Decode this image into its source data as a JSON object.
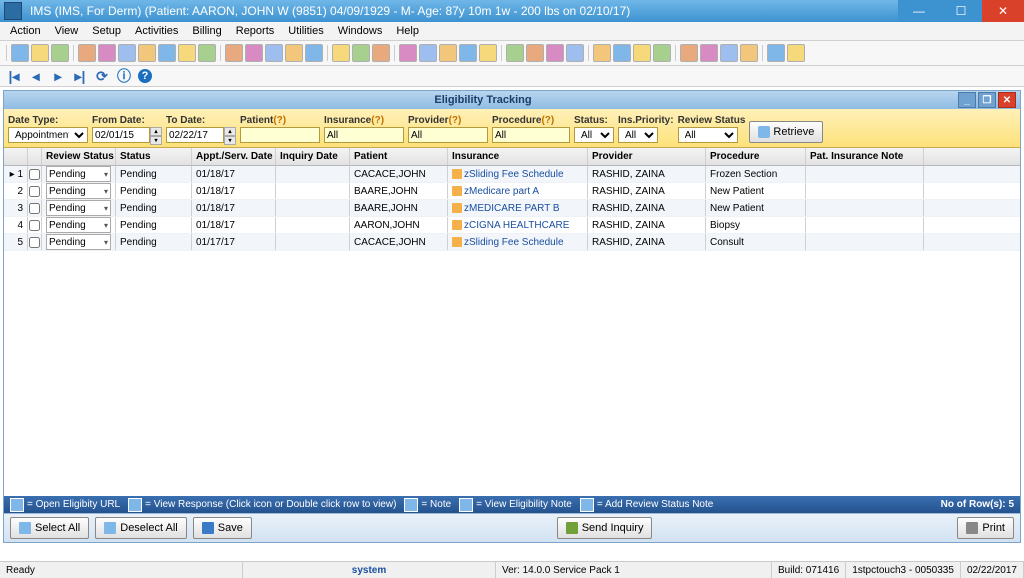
{
  "window": {
    "title": "IMS (IMS, For Derm)    (Patient: AARON, JOHN W (9851) 04/09/1929 - M- Age: 87y 10m 1w - 200 lbs on 02/10/17)"
  },
  "menu": [
    "Action",
    "View",
    "Setup",
    "Activities",
    "Billing",
    "Reports",
    "Utilities",
    "Windows",
    "Help"
  ],
  "panel_title": "Eligibility Tracking",
  "filters": {
    "date_type": {
      "label": "Date Type:",
      "value": "Appointment Da"
    },
    "from_date": {
      "label": "From Date:",
      "value": "02/01/15"
    },
    "to_date": {
      "label": "To Date:",
      "value": "02/22/17"
    },
    "patient": {
      "label": "Patient",
      "q": "(?)",
      "value": ""
    },
    "insurance": {
      "label": "Insurance",
      "q": "(?)",
      "value": "All"
    },
    "provider": {
      "label": "Provider",
      "q": "(?)",
      "value": "All"
    },
    "procedure": {
      "label": "Procedure",
      "q": "(?)",
      "value": "All"
    },
    "status": {
      "label": "Status:",
      "value": "All"
    },
    "ins_priority": {
      "label": "Ins.Priority:",
      "value": "All"
    },
    "review_status": {
      "label": "Review Status",
      "value": "All"
    },
    "retrieve": "Retrieve"
  },
  "grid": {
    "headers": {
      "rs": "Review Status",
      "st": "Status",
      "dt": "Appt./Serv. Date",
      "iq": "Inquiry Date",
      "pt": "Patient",
      "ins": "Insurance",
      "prov": "Provider",
      "proc": "Procedure",
      "note": "Pat. Insurance Note"
    },
    "rows": [
      {
        "n": "1",
        "rs": "Pending",
        "st": "Pending",
        "dt": "01/18/17",
        "iq": "",
        "pt": "CACACE,JOHN",
        "ins": "Sliding Fee Schedule",
        "prov": "RASHID, ZAINA",
        "proc": "Frozen Section",
        "note": ""
      },
      {
        "n": "2",
        "rs": "Pending",
        "st": "Pending",
        "dt": "01/18/17",
        "iq": "",
        "pt": "BAARE,JOHN",
        "ins": "Medicare part A",
        "prov": "RASHID, ZAINA",
        "proc": "New Patient",
        "note": ""
      },
      {
        "n": "3",
        "rs": "Pending",
        "st": "Pending",
        "dt": "01/18/17",
        "iq": "",
        "pt": "BAARE,JOHN",
        "ins": "MEDICARE PART B",
        "prov": "RASHID, ZAINA",
        "proc": "New Patient",
        "note": ""
      },
      {
        "n": "4",
        "rs": "Pending",
        "st": "Pending",
        "dt": "01/18/17",
        "iq": "",
        "pt": "AARON,JOHN",
        "ins": "CIGNA HEALTHCARE",
        "prov": "RASHID, ZAINA",
        "proc": "Biopsy",
        "note": ""
      },
      {
        "n": "5",
        "rs": "Pending",
        "st": "Pending",
        "dt": "01/17/17",
        "iq": "",
        "pt": "CACACE,JOHN",
        "ins": "Sliding Fee Schedule",
        "prov": "RASHID, ZAINA",
        "proc": "Consult",
        "note": ""
      }
    ]
  },
  "legend": {
    "items": [
      "= Open Eligibity URL",
      "= View Response (Click icon or Double click row to view)",
      "= Note",
      "= View Eligibility Note",
      "= Add Review Status Note"
    ],
    "rowcount_label": "No of Row(s):",
    "rowcount": "5"
  },
  "buttons": {
    "select_all": "Select All",
    "deselect_all": "Deselect All",
    "save": "Save",
    "send_inquiry": "Send Inquiry",
    "print": "Print"
  },
  "status": {
    "ready": "Ready",
    "system": "system",
    "ver": "Ver: 14.0.0 Service Pack 1",
    "build": "Build: 071416",
    "host": "1stpctouch3 - 0050335",
    "date": "02/22/2017"
  }
}
